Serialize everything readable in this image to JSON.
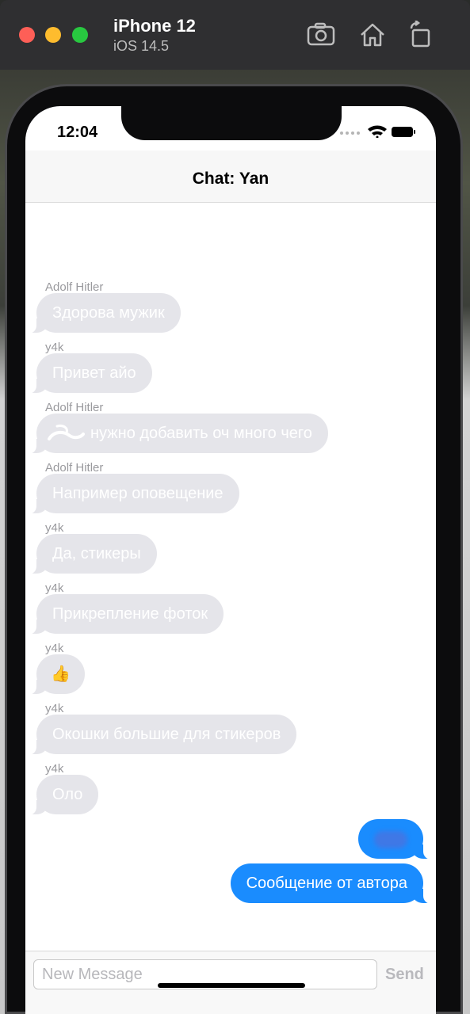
{
  "simulator": {
    "device_name": "iPhone 12",
    "os_version": "iOS 14.5",
    "toolbar_icons": [
      "screenshot-icon",
      "home-icon",
      "rotate-icon"
    ]
  },
  "status_bar": {
    "time": "12:04"
  },
  "nav": {
    "title": "Chat: Yan"
  },
  "messages": [
    {
      "sender": "Adolf Hitler",
      "text": "Здорова мужик",
      "direction": "incoming"
    },
    {
      "sender": "y4k",
      "text": "Привет айо",
      "direction": "incoming"
    },
    {
      "sender": "Adolf Hitler",
      "text": "нужно добавить оч много чего",
      "direction": "incoming"
    },
    {
      "sender": "Adolf Hitler",
      "text": "Например оповещение",
      "direction": "incoming"
    },
    {
      "sender": "y4k",
      "text": "Да, стикеры",
      "direction": "incoming"
    },
    {
      "sender": "y4k",
      "text": "Прикрепление фоток",
      "direction": "incoming"
    },
    {
      "sender": "y4k",
      "text": "👍",
      "direction": "incoming"
    },
    {
      "sender": "y4k",
      "text": "Окошки большие для стикеров",
      "direction": "incoming"
    },
    {
      "sender": "y4k",
      "text": "Оло",
      "direction": "incoming"
    },
    {
      "text": "",
      "direction": "outgoing"
    },
    {
      "text": "Сообщение от автора",
      "direction": "outgoing"
    }
  ],
  "composer": {
    "placeholder": "New Message",
    "value": "",
    "send_label": "Send"
  },
  "colors": {
    "incoming_bubble": "#e5e5ea",
    "outgoing_bubble": "#1a8cfe",
    "sender_label": "#9a9a9e"
  }
}
